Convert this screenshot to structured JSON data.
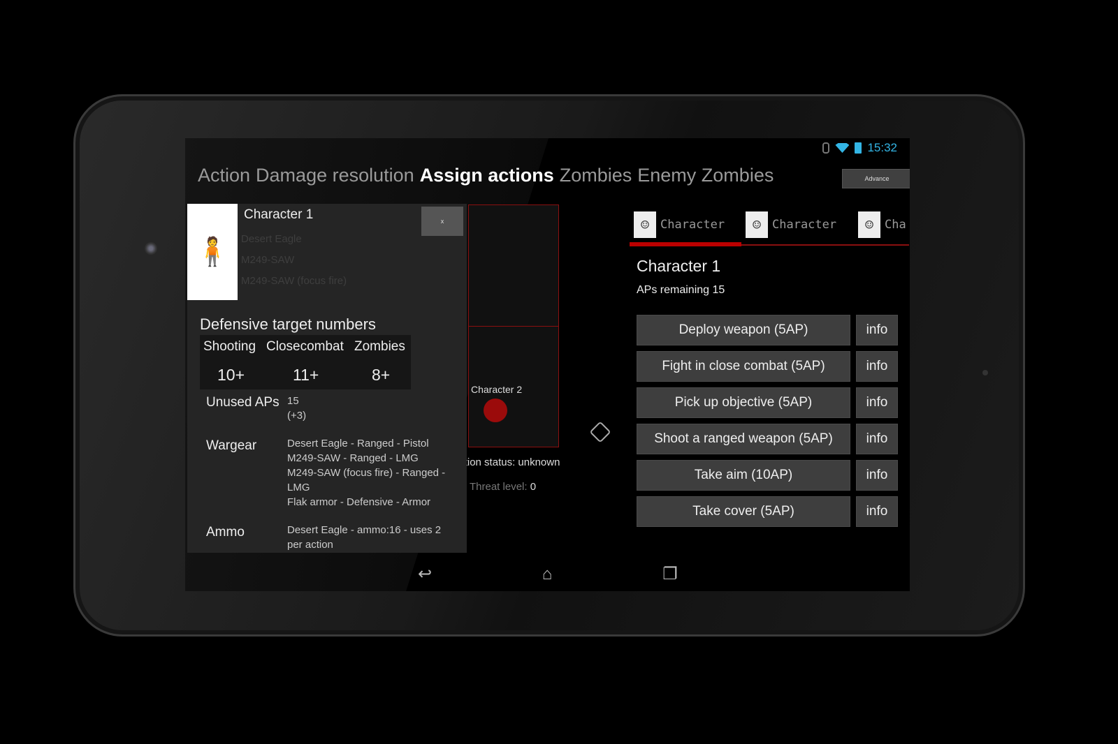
{
  "status": {
    "time": "15:32",
    "accent": "#33b5e5"
  },
  "top_tabs": [
    "Action",
    "Damage resolution",
    "Assign actions",
    "Zombies",
    "Enemy Zombies"
  ],
  "active_tab": "Assign actions",
  "advance_label": "Advance",
  "map": {
    "character2_label": "Character 2",
    "connection": "Connection status: unknown",
    "threat_label": "Threat level:",
    "threat_value": "0",
    "marker_color": "#9b0b0b"
  },
  "panel": {
    "name": "Character 1",
    "close_label": "x",
    "ghost_items": [
      "Desert Eagle",
      "M249-SAW",
      "M249-SAW (focus fire)"
    ],
    "defensive_title": "Defensive target numbers",
    "defensive_headers": [
      "Shooting",
      "Closecombat",
      "Zombies"
    ],
    "defensive_values": [
      "10+",
      "11+",
      "8+"
    ],
    "unused_label": "Unused APs",
    "unused_value": "15",
    "unused_bonus": "(+3)",
    "wargear_label": "Wargear",
    "wargear": [
      "Desert Eagle - Ranged - Pistol",
      "M249-SAW - Ranged - LMG",
      "M249-SAW (focus fire) - Ranged - LMG",
      "Flak armor - Defensive - Armor"
    ],
    "ammo_label": "Ammo",
    "ammo": "Desert Eagle - ammo:16 - uses 2 per action"
  },
  "right": {
    "char_tabs": [
      "Character",
      "Character",
      "Cha"
    ],
    "name": "Character 1",
    "aps": "APs remaining 15",
    "actions": [
      "Deploy weapon (5AP)",
      "Fight in close combat (5AP)",
      "Pick up objective (5AP)",
      "Shoot a ranged weapon (5AP)",
      "Take aim (10AP)",
      "Take cover (5AP)"
    ],
    "info_label": "info",
    "accent": "#b00000"
  }
}
